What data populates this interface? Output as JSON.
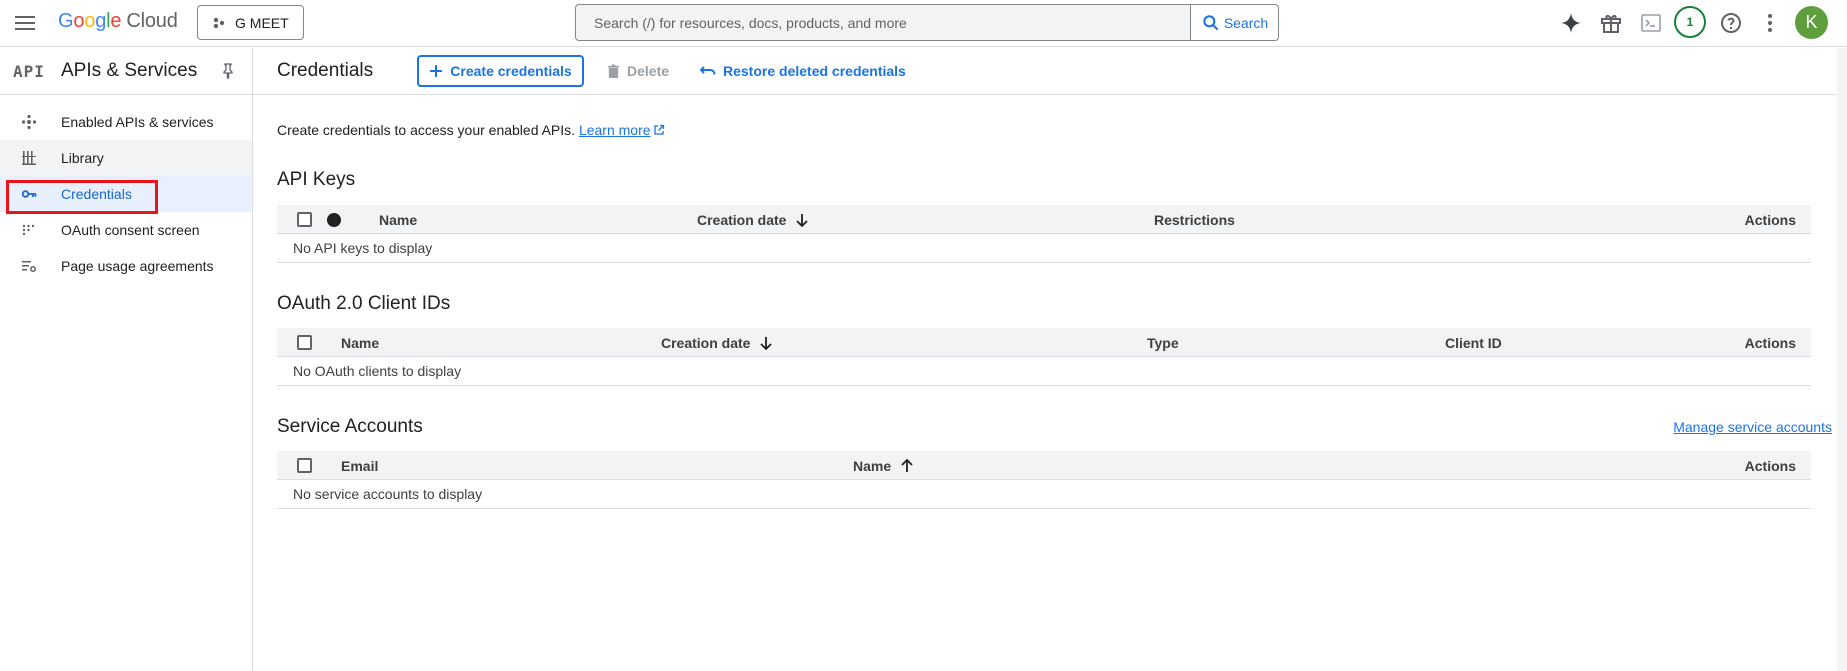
{
  "topbar": {
    "logo_google": "Google",
    "logo_cloud": "Cloud",
    "project_name": "G MEET",
    "search_placeholder": "Search (/) for resources, docs, products, and more",
    "search_button": "Search",
    "notification_count": "1",
    "avatar_initial": "K",
    "icons": [
      "menu-icon",
      "project-icon",
      "search-icon",
      "gemini-sparkle-icon",
      "gift-icon",
      "cloud-shell-icon",
      "help-icon",
      "more-vert-icon"
    ]
  },
  "sidebar": {
    "glyph": "API",
    "title": "APIs & Services",
    "items": [
      {
        "label": "Enabled APIs & services",
        "icon": "hub-icon"
      },
      {
        "label": "Library",
        "icon": "library-icon"
      },
      {
        "label": "Credentials",
        "icon": "key-icon"
      },
      {
        "label": "OAuth consent screen",
        "icon": "consent-icon"
      },
      {
        "label": "Page usage agreements",
        "icon": "settings-list-icon"
      }
    ]
  },
  "main": {
    "title": "Credentials",
    "create_label": "Create credentials",
    "delete_label": "Delete",
    "restore_label": "Restore deleted credentials",
    "intro_text": "Create credentials to access your enabled APIs.",
    "learn_more": "Learn more",
    "api_keys": {
      "title": "API Keys",
      "columns": [
        "Name",
        "Creation date",
        "Restrictions",
        "Actions"
      ],
      "empty": "No API keys to display"
    },
    "oauth": {
      "title": "OAuth 2.0 Client IDs",
      "columns": [
        "Name",
        "Creation date",
        "Type",
        "Client ID",
        "Actions"
      ],
      "empty": "No OAuth clients to display"
    },
    "service_accounts": {
      "title": "Service Accounts",
      "manage_link": "Manage service accounts",
      "columns": [
        "Email",
        "Name",
        "Actions"
      ],
      "empty": "No service accounts to display"
    }
  }
}
